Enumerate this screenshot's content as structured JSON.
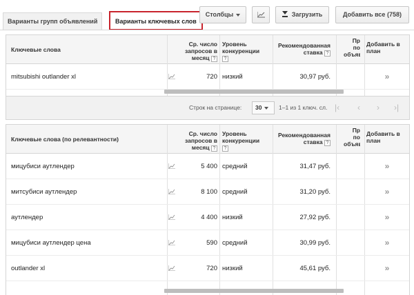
{
  "tabs": [
    {
      "label": "Варианты групп объявлений"
    },
    {
      "label": "Варианты ключевых слов"
    }
  ],
  "toolbar": {
    "columns_label": "Столбцы",
    "download_label": "Загрузить",
    "add_all_label": "Добавить все (758)"
  },
  "columns": {
    "keyword": "Ключевые слова",
    "keyword_relevance": "Ключевые слова (по релевантности)",
    "volume_l1": "Ср. число",
    "volume_l2": "запросов в",
    "volume_l3": "месяц",
    "competition_l1": "Уровень",
    "competition_l2": "конкуренции",
    "bid_l1": "Рекомендованная",
    "bid_l2": "ставка",
    "share_l1": "Пр",
    "share_l2": "по",
    "share_l3": "объявле",
    "add_l1": "Добавить в",
    "add_l2": "план",
    "help": "?"
  },
  "table_top": {
    "rows": [
      {
        "keyword": "mitsubishi outlander xl",
        "volume": "720",
        "competition": "низкий",
        "bid": "30,97 руб.",
        "add": "»"
      }
    ]
  },
  "pager": {
    "rows_per_page_label": "Строк на странице:",
    "rows_per_page": "30",
    "range": "1–1 из 1 ключ. сл.",
    "first": "|‹",
    "prev": "‹",
    "next": "›",
    "last": "›|"
  },
  "table_bottom": {
    "rows": [
      {
        "keyword": "мицубиси аутлендер",
        "volume": "5 400",
        "competition": "средний",
        "bid": "31,47 руб.",
        "add": "»"
      },
      {
        "keyword": "митсубиси аутлендер",
        "volume": "8 100",
        "competition": "средний",
        "bid": "31,20 руб.",
        "add": "»"
      },
      {
        "keyword": "аутлендер",
        "volume": "4 400",
        "competition": "низкий",
        "bid": "27,92 руб.",
        "add": "»"
      },
      {
        "keyword": "мицубиси аутлендер цена",
        "volume": "590",
        "competition": "средний",
        "bid": "30,99 руб.",
        "add": "»"
      },
      {
        "keyword": "outlander xl",
        "volume": "720",
        "competition": "низкий",
        "bid": "45,61 руб.",
        "add": "»"
      }
    ]
  },
  "icons": {
    "chart": "trend-chart-icon",
    "download": "download-icon",
    "dropdown": "chevron-down-icon",
    "add": "double-chevron-right-icon"
  },
  "colors": {
    "active_tab_border": "#c8232c",
    "header_bg": "#f5f5f5",
    "pager_bg": "#f1f1f1"
  }
}
